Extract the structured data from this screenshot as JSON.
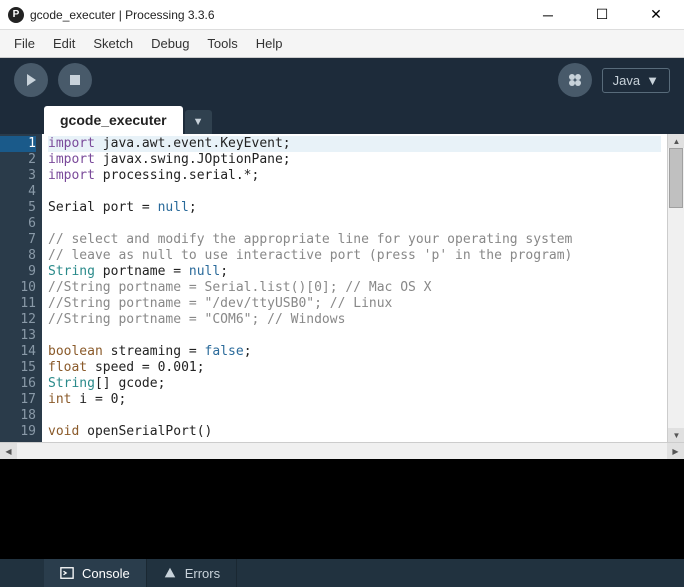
{
  "window": {
    "title": "gcode_executer | Processing 3.3.6",
    "app_letter": "P"
  },
  "menubar": [
    "File",
    "Edit",
    "Sketch",
    "Debug",
    "Tools",
    "Help"
  ],
  "toolbar": {
    "mode_label": "Java"
  },
  "tabs": {
    "active": "gcode_executer"
  },
  "editor": {
    "current_line": 1,
    "lines": [
      {
        "n": 1,
        "tokens": [
          {
            "t": "import",
            "c": "kw-purple"
          },
          {
            "t": " java.awt.event.KeyEvent;",
            "c": ""
          }
        ]
      },
      {
        "n": 2,
        "tokens": [
          {
            "t": "import",
            "c": "kw-purple"
          },
          {
            "t": " javax.swing.JOptionPane;",
            "c": ""
          }
        ]
      },
      {
        "n": 3,
        "tokens": [
          {
            "t": "import",
            "c": "kw-purple"
          },
          {
            "t": " processing.serial.*;",
            "c": ""
          }
        ]
      },
      {
        "n": 4,
        "tokens": []
      },
      {
        "n": 5,
        "tokens": [
          {
            "t": "Serial port = ",
            "c": ""
          },
          {
            "t": "null",
            "c": "kw-null"
          },
          {
            "t": ";",
            "c": ""
          }
        ]
      },
      {
        "n": 6,
        "tokens": []
      },
      {
        "n": 7,
        "tokens": [
          {
            "t": "// select and modify the appropriate line for your operating system",
            "c": "comment"
          }
        ]
      },
      {
        "n": 8,
        "tokens": [
          {
            "t": "// leave as null to use interactive port (press 'p' in the program)",
            "c": "comment"
          }
        ]
      },
      {
        "n": 9,
        "tokens": [
          {
            "t": "String",
            "c": "kw-teal"
          },
          {
            "t": " portname = ",
            "c": ""
          },
          {
            "t": "null",
            "c": "kw-null"
          },
          {
            "t": ";",
            "c": ""
          }
        ]
      },
      {
        "n": 10,
        "tokens": [
          {
            "t": "//String portname = Serial.list()[0]; // Mac OS X",
            "c": "comment"
          }
        ]
      },
      {
        "n": 11,
        "tokens": [
          {
            "t": "//String portname = \"/dev/ttyUSB0\"; // Linux",
            "c": "comment"
          }
        ]
      },
      {
        "n": 12,
        "tokens": [
          {
            "t": "//String portname = \"COM6\"; // Windows",
            "c": "comment"
          }
        ]
      },
      {
        "n": 13,
        "tokens": []
      },
      {
        "n": 14,
        "tokens": [
          {
            "t": "boolean",
            "c": "kw-brown"
          },
          {
            "t": " streaming = ",
            "c": ""
          },
          {
            "t": "false",
            "c": "kw-null"
          },
          {
            "t": ";",
            "c": ""
          }
        ]
      },
      {
        "n": 15,
        "tokens": [
          {
            "t": "float",
            "c": "kw-brown"
          },
          {
            "t": " speed = ",
            "c": ""
          },
          {
            "t": "0.001",
            "c": "num"
          },
          {
            "t": ";",
            "c": ""
          }
        ]
      },
      {
        "n": 16,
        "tokens": [
          {
            "t": "String",
            "c": "kw-teal"
          },
          {
            "t": "[] gcode;",
            "c": ""
          }
        ]
      },
      {
        "n": 17,
        "tokens": [
          {
            "t": "int",
            "c": "kw-brown"
          },
          {
            "t": " i = ",
            "c": ""
          },
          {
            "t": "0",
            "c": "num"
          },
          {
            "t": ";",
            "c": ""
          }
        ]
      },
      {
        "n": 18,
        "tokens": []
      },
      {
        "n": 19,
        "tokens": [
          {
            "t": "void",
            "c": "kw-brown"
          },
          {
            "t": " openSerialPort()",
            "c": ""
          }
        ]
      }
    ]
  },
  "bottom": {
    "console": "Console",
    "errors": "Errors"
  }
}
